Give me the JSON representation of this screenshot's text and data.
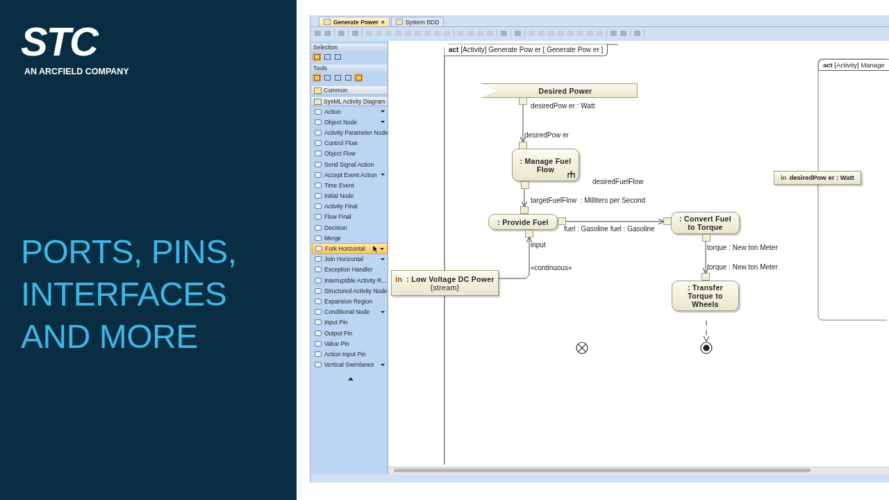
{
  "slide": {
    "logo": "STC",
    "tagline": "AN ARCFIELD COMPANY",
    "title_lines": [
      "PORTS, PINS,",
      "INTERFACES",
      "AND MORE"
    ]
  },
  "tabs": [
    {
      "label": "Generate Power",
      "selected": true,
      "close": "×"
    },
    {
      "label": "System BDD",
      "selected": false
    }
  ],
  "palette": {
    "selection_header": "Selection",
    "selection_tools": [
      {
        "selected": true
      },
      {
        "selected": false
      },
      {
        "selected": false
      }
    ],
    "tools_header": "Tools",
    "tools": [
      {
        "selected": true
      },
      {
        "selected": false
      },
      {
        "selected": false
      },
      {
        "selected": false
      },
      {
        "selected": true
      }
    ],
    "groups": [
      {
        "kind": "folder",
        "label": "Common"
      },
      {
        "kind": "group",
        "label": "SysML Activity Diagram"
      }
    ],
    "items": [
      {
        "label": "Action",
        "has_menu": true,
        "selected": false
      },
      {
        "label": "Object Node",
        "has_menu": true,
        "selected": false
      },
      {
        "label": "Activity Parameter Node",
        "has_menu": false,
        "selected": false
      },
      {
        "label": "Control Flow",
        "has_menu": false,
        "selected": false
      },
      {
        "label": "Object Flow",
        "has_menu": false,
        "selected": false
      },
      {
        "label": "Send Signal Action",
        "has_menu": false,
        "selected": false
      },
      {
        "label": "Accept Event Action",
        "has_menu": true,
        "selected": false
      },
      {
        "label": "Time Event",
        "has_menu": false,
        "selected": false
      },
      {
        "label": "Initial Node",
        "has_menu": false,
        "selected": false
      },
      {
        "label": "Activity Final",
        "has_menu": false,
        "selected": false
      },
      {
        "label": "Flow Final",
        "has_menu": false,
        "selected": false
      },
      {
        "label": "Decision",
        "has_menu": false,
        "selected": false
      },
      {
        "label": "Merge",
        "has_menu": false,
        "selected": false
      },
      {
        "label": "Fork Horizontal",
        "has_menu": true,
        "selected": true
      },
      {
        "label": "Join Horizontal",
        "has_menu": true,
        "selected": false
      },
      {
        "label": "Exception Handler",
        "has_menu": false,
        "selected": false
      },
      {
        "label": "Interruptible Activity R...",
        "has_menu": false,
        "selected": false
      },
      {
        "label": "Structured Activity Node",
        "has_menu": false,
        "selected": false
      },
      {
        "label": "Expansion Region",
        "has_menu": false,
        "selected": false
      },
      {
        "label": "Conditional Node",
        "has_menu": true,
        "selected": false
      },
      {
        "label": "Input Pin",
        "has_menu": false,
        "selected": false
      },
      {
        "label": "Output Pin",
        "has_menu": false,
        "selected": false
      },
      {
        "label": "Value Pin",
        "has_menu": false,
        "selected": false
      },
      {
        "label": "Action Input Pin",
        "has_menu": false,
        "selected": false
      },
      {
        "label": "Vertical Swimlanes",
        "has_menu": true,
        "selected": false
      }
    ]
  },
  "diagram": {
    "frames": [
      {
        "keyword": "act",
        "title": "[Activity]  Generate Pow er [ Generate Pow er ]"
      },
      {
        "keyword": "act",
        "title": "[Activity] Manage"
      }
    ],
    "nodes": [
      {
        "kind": "signal",
        "label": "Desired Power"
      },
      {
        "kind": "action",
        "label": ": Manage Fuel Flow",
        "call_behavior": true
      },
      {
        "kind": "action",
        "label": ": Provide Fuel",
        "call_behavior": false
      },
      {
        "kind": "action",
        "label": ": Convert Fuel to Torque",
        "call_behavior": false
      },
      {
        "kind": "action",
        "label": ": Transfer Torque to Wheels",
        "call_behavior": false
      },
      {
        "kind": "parameter",
        "keyword": "in",
        "label": ": Low Voltage DC Power",
        "constraint": "{stream}"
      },
      {
        "kind": "parameter",
        "keyword": "in",
        "label": "desiredPow er : Watt"
      },
      {
        "kind": "flow_final"
      },
      {
        "kind": "activity_final"
      }
    ],
    "labels": [
      "desiredPow er : Watt",
      "desiredPow er",
      "desiredFuelFlow",
      "targetFuelFlow  : Milliters per Second",
      "fuel : Gasoline fuel : Gasoline",
      "input",
      "«continuous»",
      "torque : New ton Meter",
      "torque : New ton Meter"
    ]
  }
}
